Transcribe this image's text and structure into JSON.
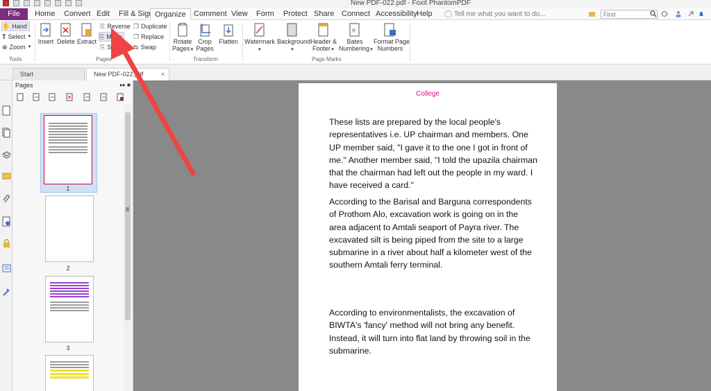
{
  "window": {
    "title": "New PDF-022.pdf - Foxit PhantomPDF"
  },
  "menu": {
    "file": "File",
    "tabs": [
      "Home",
      "Convert",
      "Edit",
      "Fill & Sign",
      "Organize",
      "Comment",
      "View",
      "Form",
      "Protect",
      "Share",
      "Connect",
      "Accessibility",
      "Help"
    ],
    "active": "Organize",
    "tell_me": "Tell me what you want to do...",
    "search_placeholder": "Find"
  },
  "ribbon": {
    "tools": {
      "hand": "Hand",
      "select": "Select",
      "zoom": "Zoom",
      "label": "Tools"
    },
    "pages": {
      "insert": "Insert",
      "delete": "Delete",
      "extract": "Extract",
      "reverse": "Reverse",
      "move": "Move",
      "split": "Split",
      "duplicate": "Duplicate",
      "replace": "Replace",
      "swap": "Swap",
      "label": "Pages"
    },
    "transform": {
      "rotate_pages_1": "Rotate",
      "rotate_pages_2": "Pages",
      "crop_pages_1": "Crop",
      "crop_pages_2": "Pages",
      "flatten": "Flatten",
      "label": "Transform"
    },
    "page_marks": {
      "watermark": "Watermark",
      "background": "Background",
      "header_footer_1": "Header &",
      "header_footer_2": "Footer",
      "bates_1": "Bates",
      "bates_2": "Numbering",
      "format_1": "Format Page",
      "format_2": "Numbers",
      "label": "Page Marks"
    }
  },
  "doc_tabs": [
    {
      "label": "Start"
    },
    {
      "label": "New PDF-022.pdf"
    }
  ],
  "pages_panel": {
    "title": "Pages",
    "thumbs": [
      {
        "num": "1"
      },
      {
        "num": "2"
      },
      {
        "num": "3"
      }
    ]
  },
  "document": {
    "header": "College",
    "paragraphs": [
      "These lists are prepared by the local people's representatives i.e. UP chairman and members. One UP member said, \"I gave it to the one I got in front of me.\" Another member said, \"I told the upazila chairman that the chairman had left out the people in my ward. I have received a card.\"",
      "According to the Barisal and Barguna correspondents of Prothom Alo, excavation work is going on in the area adjacent to Amtali seaport of Payra river. The excavated silt is being piped from the site to a large submarine in a river about half a kilometer west of the southern Amtali ferry terminal.",
      "According to environmentalists, the excavation of BIWTA's 'fancy' method will not bring any benefit. Instead, it will turn into flat land by throwing soil in the submarine."
    ]
  },
  "colors": {
    "file_tab": "#7b2d7e",
    "accent_header": "#d4127f",
    "annotation_arrow": "#ee4444",
    "canvas_bg": "#898989"
  }
}
